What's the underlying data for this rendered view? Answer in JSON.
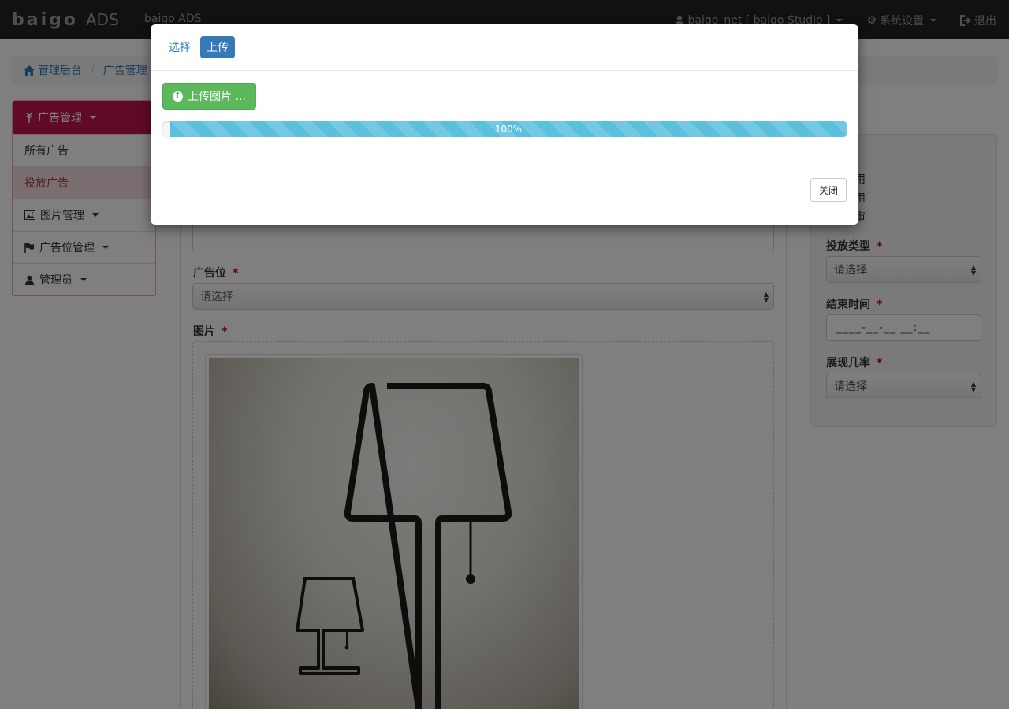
{
  "navbar": {
    "logo_mark": "baigo",
    "logo_suffix": "ADS",
    "brand_text": "baigo ADS",
    "user_label": "baigo_net [ baigo Studio ]",
    "settings_label": "系统设置",
    "logout_label": "退出"
  },
  "breadcrumb": {
    "items": [
      "管理后台",
      "广告管理"
    ]
  },
  "sidebar": {
    "header": "广告管理",
    "items": [
      {
        "label": "所有广告"
      },
      {
        "label": "投放广告"
      },
      {
        "label": "图片管理"
      },
      {
        "label": "广告位管理"
      },
      {
        "label": "管理员"
      }
    ]
  },
  "form": {
    "position_label": "广告位",
    "position_select": "请选择",
    "image_label": "图片",
    "required_mark": "*"
  },
  "right_panel": {
    "radio_partials": [
      "用",
      "用",
      "审"
    ],
    "type_label": "投放类型",
    "type_select": "请选择",
    "end_time_label": "结束时间",
    "end_time_placeholder": "____-__-__ __:__",
    "rate_label": "展现几率",
    "rate_select": "请选择"
  },
  "modal": {
    "tabs": [
      {
        "label": "选择",
        "active": false
      },
      {
        "label": "上传",
        "active": true
      }
    ],
    "upload_button": "上传图片 ...",
    "progress": {
      "value": 1.0,
      "label": "100%"
    },
    "close_button": "关闭"
  },
  "colors": {
    "navbar_bg": "#222222",
    "sidebar_accent": "#c0154d",
    "primary": "#337ab7",
    "success": "#5cb85c",
    "info": "#5bc0de"
  },
  "icons": {
    "home": "home-icon",
    "user": "user-icon",
    "gear": "gear-icon",
    "logout": "logout-icon",
    "image": "picture-icon",
    "flag": "flag-icon",
    "upload": "upload-circle-icon"
  }
}
